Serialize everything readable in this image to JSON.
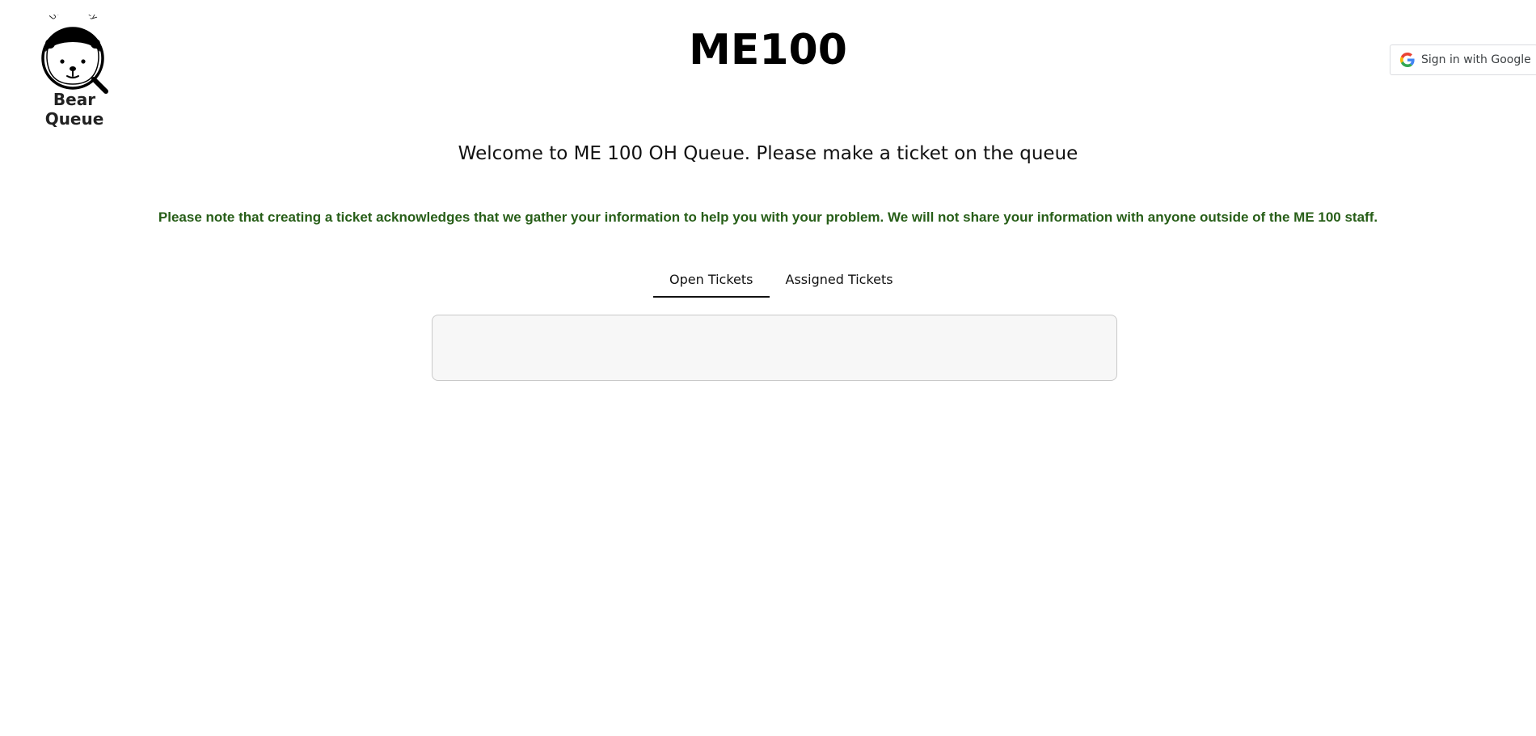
{
  "header": {
    "logo": {
      "arc_text": "Uc berkeley",
      "brand_name": "Bear Queue",
      "icon": "bear-magnifier-icon"
    },
    "course_title": "ME100",
    "sign_in_button": {
      "label": "Sign in with Google",
      "icon": "google-g-icon"
    }
  },
  "main": {
    "welcome_message": "Welcome to ME 100 OH Queue. Please make a ticket on the queue",
    "notice": "Please note that creating a ticket acknowledges that we gather your information to help you with your problem.  We will not share your information with anyone outside of the ME 100 staff.",
    "notice_color": "#275e18",
    "tabs": [
      {
        "label": "Open Tickets",
        "active": true
      },
      {
        "label": "Assigned Tickets",
        "active": false
      }
    ],
    "ticket_list": []
  }
}
